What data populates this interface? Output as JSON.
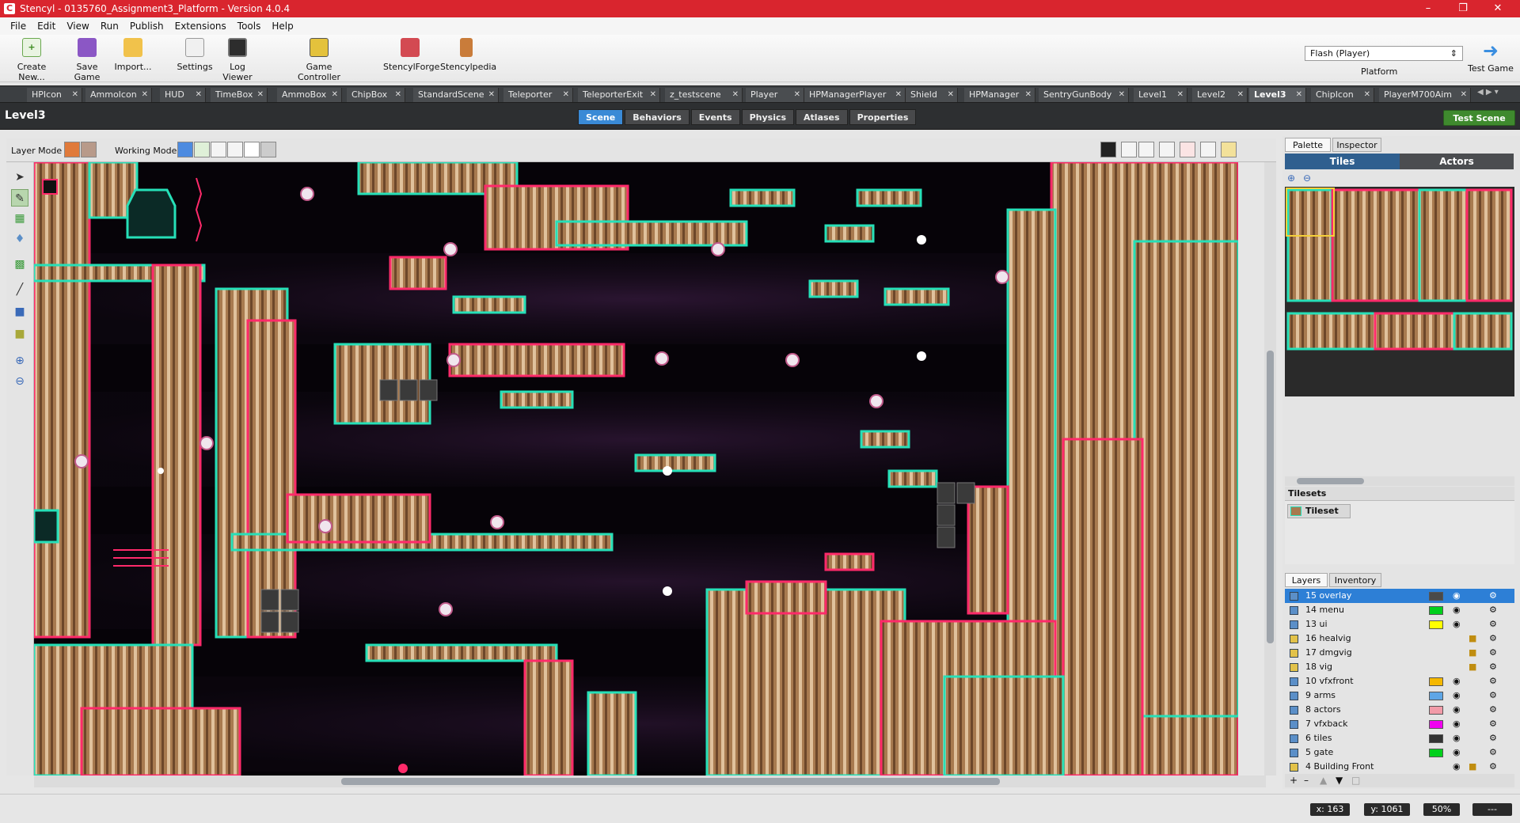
{
  "window": {
    "title": "Stencyl - 0135760_Assignment3_Platform - Version 4.0.4",
    "app_icon": "C"
  },
  "menu": [
    "File",
    "Edit",
    "View",
    "Run",
    "Publish",
    "Extensions",
    "Tools",
    "Help"
  ],
  "toolbar": {
    "buttons": [
      {
        "label": "Create New...",
        "icon": "create-new-icon"
      },
      {
        "label": "Save Game",
        "icon": "save-icon"
      },
      {
        "label": "Import...",
        "icon": "import-icon"
      },
      {
        "label": "Settings",
        "icon": "settings-icon"
      },
      {
        "label": "Log Viewer",
        "icon": "log-viewer-icon"
      },
      {
        "label": "Game Controller",
        "icon": "game-controller-icon"
      },
      {
        "label": "StencylForge",
        "icon": "stencylforge-icon"
      },
      {
        "label": "Stencylpedia",
        "icon": "stencylpedia-icon"
      }
    ],
    "platform_select": "Flash (Player)",
    "platform_label": "Platform",
    "test_game": "Test Game"
  },
  "tabs": [
    "HPIcon",
    "AmmoIcon",
    "HUD",
    "TimeBox",
    "AmmoBox",
    "ChipBox",
    "StandardScene",
    "Teleporter",
    "TeleporterExit",
    "z_testscene",
    "Player",
    "HPManagerPlayer",
    "Shield",
    "HPManager",
    "SentryGunBody",
    "Level1",
    "Level2",
    "Level3",
    "ChipIcon",
    "PlayerM700Aim"
  ],
  "active_tab": "Level3",
  "scene": {
    "name": "Level3",
    "subtabs": [
      "Scene",
      "Behaviors",
      "Events",
      "Physics",
      "Atlases",
      "Properties"
    ],
    "active_subtab": "Scene",
    "test_scene": "Test Scene",
    "layer_mode_label": "Layer Mode",
    "working_mode_label": "Working Mode"
  },
  "right": {
    "top_tabs": [
      "Palette",
      "Inspector"
    ],
    "bands": [
      "Tiles",
      "Actors"
    ],
    "tilesets_header": "Tilesets",
    "tileset_item": "Tileset",
    "bottom_tabs": [
      "Layers",
      "Inventory"
    ],
    "layers": [
      {
        "name": "15 overlay",
        "color": "#4a4a4a",
        "lock": false,
        "eye": true,
        "selected": true
      },
      {
        "name": "14 menu",
        "color": "#00d01c",
        "lock": false,
        "eye": true
      },
      {
        "name": "13 ui",
        "color": "#ffff00",
        "lock": false,
        "eye": true
      },
      {
        "name": "16 healvig",
        "color": "",
        "lock": true,
        "eye": false
      },
      {
        "name": "17 dmgvig",
        "color": "",
        "lock": true,
        "eye": false
      },
      {
        "name": "18 vig",
        "color": "",
        "lock": true,
        "eye": false
      },
      {
        "name": "10 vfxfront",
        "color": "#f5b800",
        "lock": false,
        "eye": true
      },
      {
        "name": "9 arms",
        "color": "#5ea6e6",
        "lock": false,
        "eye": true
      },
      {
        "name": "8 actors",
        "color": "#f29ba8",
        "lock": false,
        "eye": true
      },
      {
        "name": "7 vfxback",
        "color": "#f000f0",
        "lock": false,
        "eye": true
      },
      {
        "name": "6 tiles",
        "color": "#333333",
        "lock": false,
        "eye": true
      },
      {
        "name": "5 gate",
        "color": "#00d01c",
        "lock": false,
        "eye": true
      },
      {
        "name": "4 Building Front",
        "color": "",
        "lock": true,
        "eye": true
      }
    ]
  },
  "status": {
    "x": "x:  163",
    "y": "y:  1061",
    "zoom": "50%",
    "extra": "---"
  }
}
